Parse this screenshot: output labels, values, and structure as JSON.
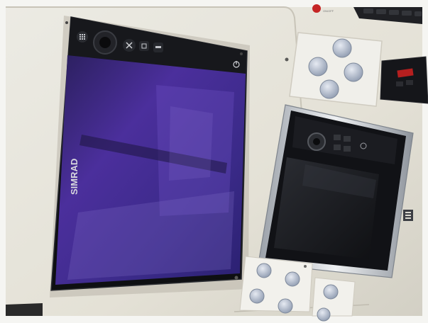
{
  "scene": {
    "description_free": true
  },
  "chartplotter": {
    "brand": "SIMRAD",
    "screen_state": "on"
  },
  "secondary_display": {
    "brand": "",
    "screen_state": "off"
  },
  "control_pad": {
    "buttons": 4
  },
  "bottom_panels": {
    "left_buttons": 4,
    "right_buttons": 2
  },
  "colors": {
    "dash": "#e9e6dc",
    "screen": "#3a2a78",
    "bezel": "#141418",
    "chrome": "#c9ccd1",
    "button": "#a9b4c6"
  }
}
